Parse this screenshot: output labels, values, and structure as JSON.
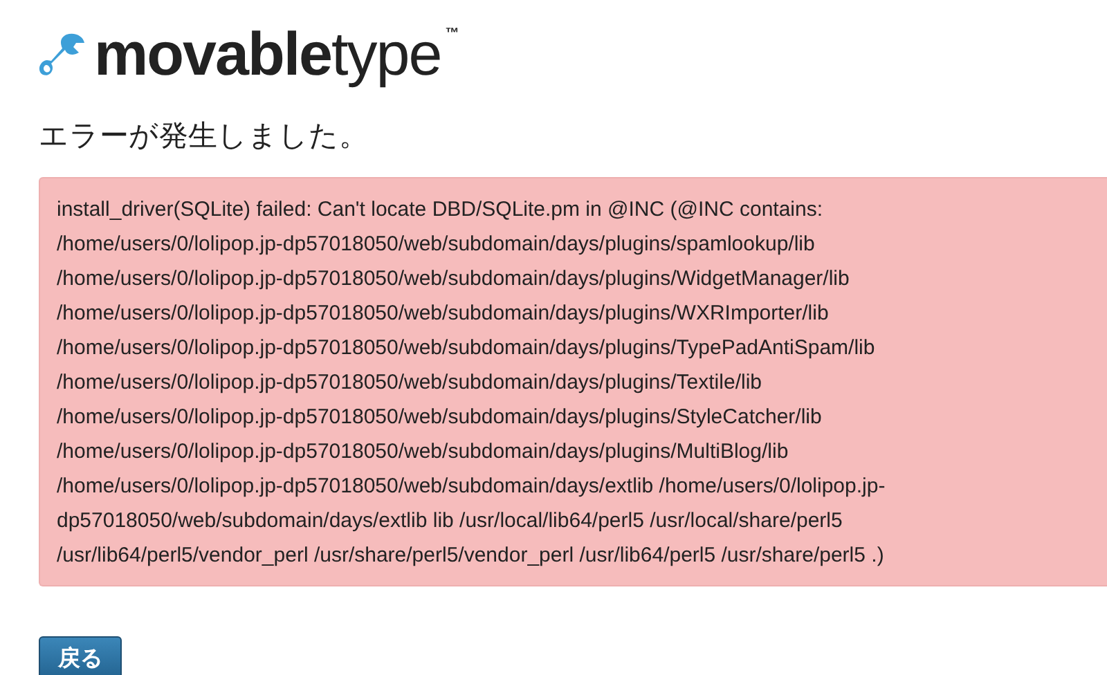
{
  "logo": {
    "wordmark": "**movable**type$^{™}$"
  },
  "heading": "エラーが発生しました。",
  "error": {
    "lines": [
      "install_driver(SQLite) failed: Can't locate DBD/SQLite.pm in @INC (@INC contains:",
      "/home/users/0/lolipop.jp-dp57018050/web/subdomain/days/plugins/spamlookup/lib",
      "/home/users/0/lolipop.jp-dp57018050/web/subdomain/days/plugins/WidgetManager/lib",
      "/home/users/0/lolipop.jp-dp57018050/web/subdomain/days/plugins/WXRImporter/lib",
      "/home/users/0/lolipop.jp-dp57018050/web/subdomain/days/plugins/TypePadAntiSpam/lib",
      "/home/users/0/lolipop.jp-dp57018050/web/subdomain/days/plugins/Textile/lib",
      "/home/users/0/lolipop.jp-dp57018050/web/subdomain/days/plugins/StyleCatcher/lib",
      "/home/users/0/lolipop.jp-dp57018050/web/subdomain/days/plugins/MultiBlog/lib",
      "/home/users/0/lolipop.jp-dp57018050/web/subdomain/days/extlib /home/users/0/lolipop.jp-",
      "dp57018050/web/subdomain/days/extlib lib /usr/local/lib64/perl5 /usr/local/share/perl5",
      "/usr/lib64/perl5/vendor_perl /usr/share/perl5/vendor_perl /usr/lib64/perl5 /usr/share/perl5 .)"
    ]
  },
  "back_button": "戻る"
}
